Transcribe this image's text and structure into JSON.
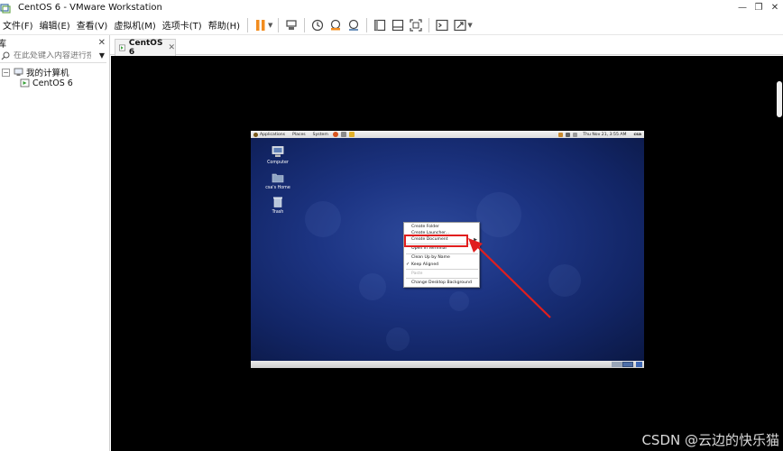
{
  "window": {
    "title": "CentOS 6 - VMware Workstation",
    "controls": [
      "—",
      "❐",
      "✕"
    ]
  },
  "menubar": {
    "items": [
      "文件(F)",
      "编辑(E)",
      "查看(V)",
      "虚拟机(M)",
      "选项卡(T)",
      "帮助(H)"
    ]
  },
  "toolbar": {
    "icons": [
      "pause-icon",
      "send-ctrl-alt-del-icon",
      "snapshot-icon",
      "restore-snapshot-icon",
      "snapshot-manager-icon",
      "show-library-icon",
      "thumbnail-bar-icon",
      "full-screen-icon",
      "console-view-icon",
      "stretch-icon"
    ],
    "accent": "#f28c1e"
  },
  "library": {
    "title": "库",
    "close": "✕",
    "search_placeholder": "在此处键入内容进行搜...",
    "tree": {
      "root_toggle": "⊟",
      "root": "我的计算机",
      "child": "CentOS 6"
    }
  },
  "tab": {
    "label": "CentOS 6",
    "close": "✕"
  },
  "guest": {
    "top_panel": {
      "menus": [
        "Applications",
        "Places",
        "System"
      ],
      "clock": "Thu Nov 21,  3:55 AM",
      "user": "csa"
    },
    "desktop_icons": [
      {
        "label": "Computer"
      },
      {
        "label": "csa's Home"
      },
      {
        "label": "Trash"
      }
    ],
    "context_menu": {
      "items": [
        {
          "label": "Create Folder"
        },
        {
          "label": "Create Launcher..."
        },
        {
          "label": "Create Document"
        },
        {
          "label": "Open in Terminal"
        },
        {
          "label": "Clean Up by Name"
        },
        {
          "label": "Keep Aligned"
        },
        {
          "label": "Paste"
        },
        {
          "label": "Change Desktop Background"
        }
      ],
      "submenu_arrow": "▶",
      "check": "✓"
    }
  },
  "annotation": {
    "color": "#e11e1e"
  },
  "watermark": "CSDN @云边的快乐猫"
}
